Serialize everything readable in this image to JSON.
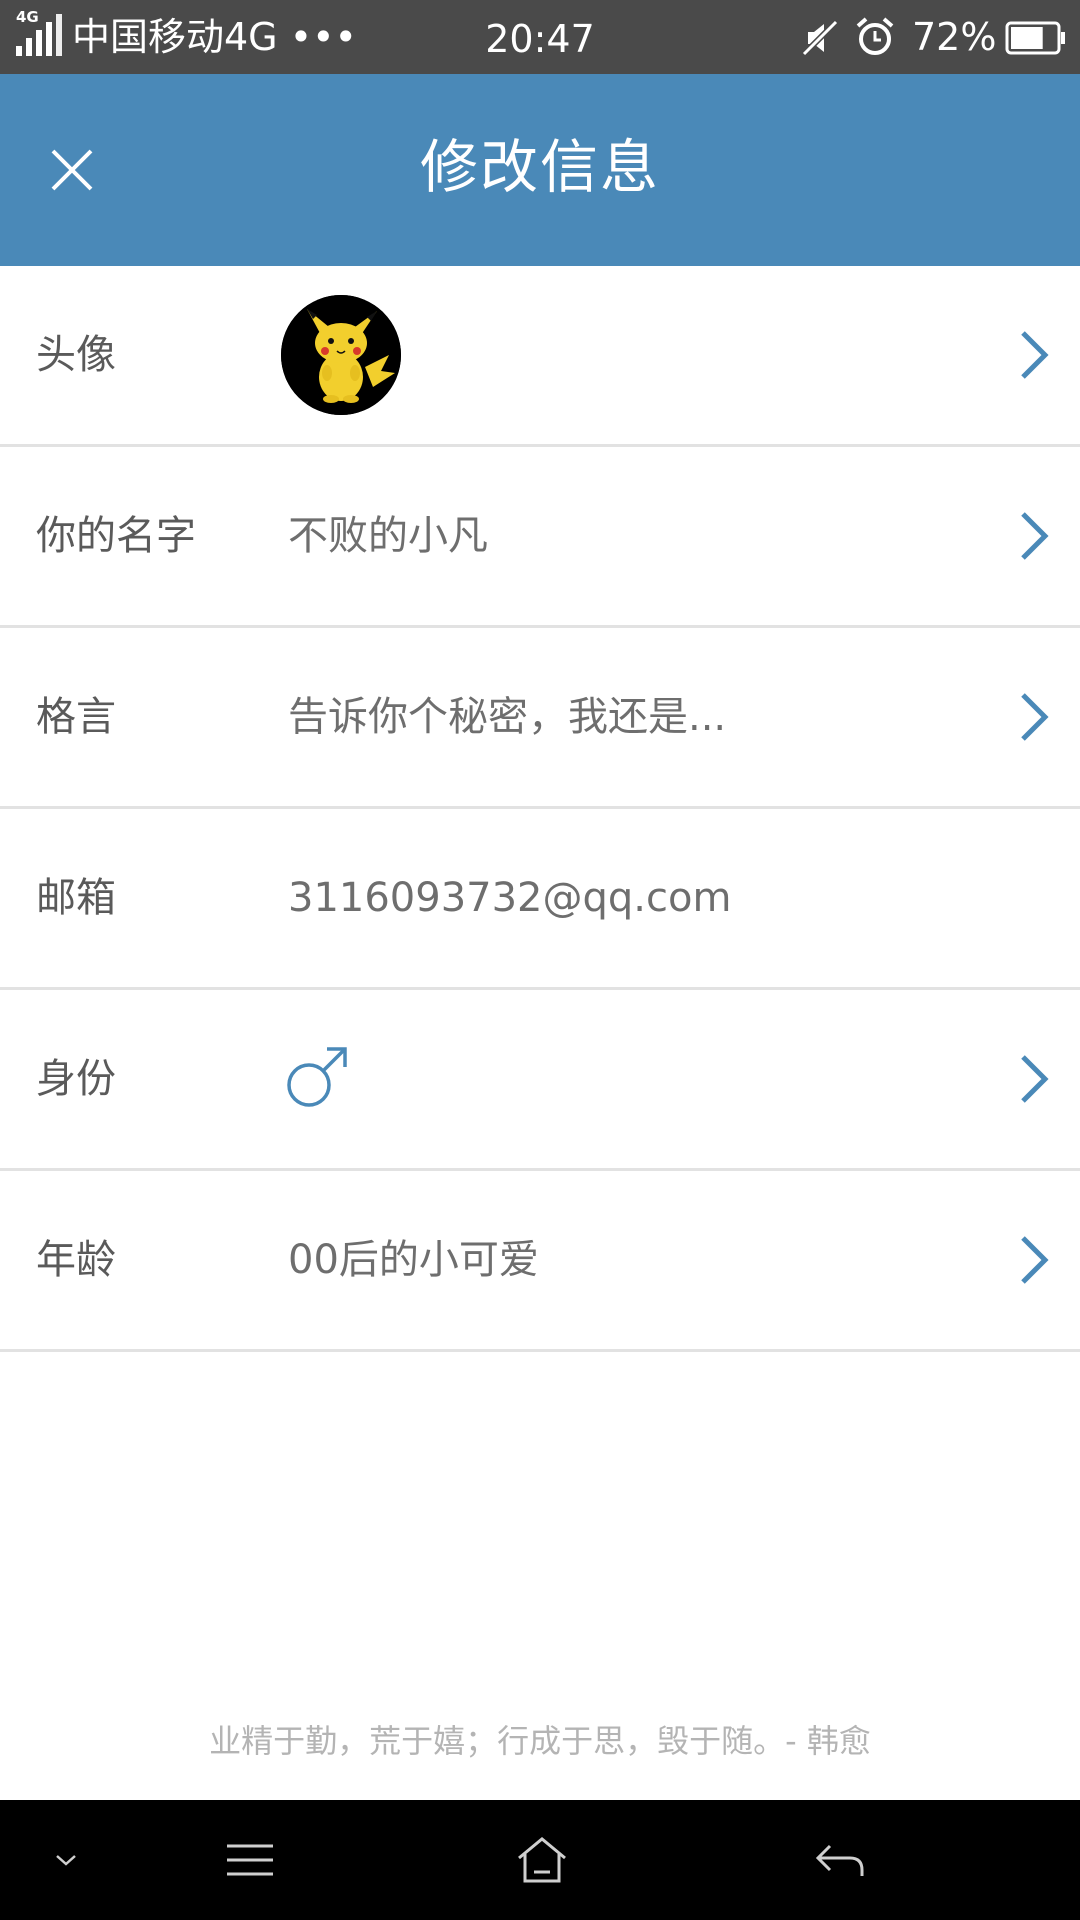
{
  "status_bar": {
    "network_tag": "4G",
    "carrier": "中国移动4G •••",
    "time": "20:47",
    "battery_percent": "72%",
    "battery_level": 0.72,
    "icons": [
      "signal-icon",
      "mute-icon",
      "alarm-icon",
      "battery-icon"
    ]
  },
  "header": {
    "title": "修改信息",
    "close_icon": "close-icon"
  },
  "profile": {
    "avatar": {
      "label": "头像"
    },
    "name": {
      "label": "你的名字",
      "value": "不败的小凡"
    },
    "motto": {
      "label": "格言",
      "value": "告诉你个秘密，我还是..."
    },
    "email": {
      "label": "邮箱",
      "value": "3116093732@qq.com"
    },
    "identity": {
      "label": "身份",
      "value_icon": "male-icon"
    },
    "age": {
      "label": "年龄",
      "value": "00后的小可爱"
    }
  },
  "footer": {
    "quote": "业精于勤，荒于嬉；行成于思，毁于随。- 韩愈"
  },
  "nav_bar": {
    "icons": [
      "collapse-icon",
      "menu-icon",
      "home-icon",
      "back-icon"
    ]
  },
  "colors": {
    "header_bg": "#4a89b8",
    "accent": "#4a89b8",
    "status_bar_bg": "#4a4a4a",
    "nav_bar_bg": "#000000",
    "divider": "#e2e2e2",
    "label_text": "#5a5a5a",
    "value_text": "#6e6e6e",
    "quote_text": "#b4b4b4"
  }
}
